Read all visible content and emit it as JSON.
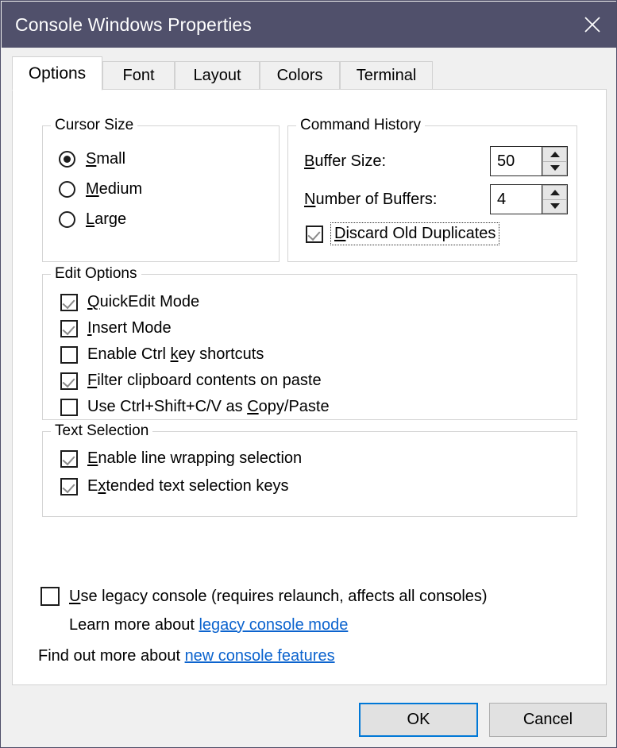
{
  "window": {
    "title": "Console Windows Properties",
    "close_icon": "close-icon",
    "titlebar_color": "#50506b"
  },
  "tabs": [
    {
      "label": "Options",
      "active": true
    },
    {
      "label": "Font",
      "active": false
    },
    {
      "label": "Layout",
      "active": false
    },
    {
      "label": "Colors",
      "active": false
    },
    {
      "label": "Terminal",
      "active": false
    }
  ],
  "cursor_size": {
    "title": "Cursor Size",
    "options": [
      {
        "label": "Small",
        "accel": "S",
        "rest": "mall",
        "selected": true
      },
      {
        "label": "Medium",
        "accel": "M",
        "rest": "edium",
        "selected": false
      },
      {
        "label": "Large",
        "accel": "L",
        "rest": "arge",
        "selected": false
      }
    ]
  },
  "command_history": {
    "title": "Command History",
    "buffer_size": {
      "label_accel": "B",
      "label_rest": "uffer Size:",
      "value": "50"
    },
    "number_of_buffers": {
      "label_accel": "N",
      "label_rest": "umber of Buffers:",
      "value": "4"
    },
    "discard_old_duplicates": {
      "accel": "D",
      "rest": "iscard Old Duplicates",
      "checked": true,
      "focused": true
    }
  },
  "edit_options": {
    "title": "Edit Options",
    "items": [
      {
        "pre": "",
        "accel": "Q",
        "rest": "uickEdit Mode",
        "checked": true
      },
      {
        "pre": "",
        "accel": "I",
        "rest": "nsert Mode",
        "checked": true
      },
      {
        "pre": "Enable Ctrl ",
        "accel": "k",
        "rest": "ey shortcuts",
        "checked": false
      },
      {
        "pre": "",
        "accel": "F",
        "rest": "ilter clipboard contents on paste",
        "checked": true
      },
      {
        "pre": "Use Ctrl+Shift+C/V as ",
        "accel": "C",
        "rest": "opy/Paste",
        "checked": false
      }
    ]
  },
  "text_selection": {
    "title": "Text Selection",
    "items": [
      {
        "pre": "",
        "accel": "E",
        "rest": "nable line wrapping selection",
        "checked": true
      },
      {
        "pre": "E",
        "accel": "x",
        "rest": "tended text selection keys",
        "checked": true
      }
    ]
  },
  "legacy": {
    "checkbox": {
      "accel": "U",
      "rest": "se legacy console (requires relaunch, affects all consoles)",
      "checked": false
    },
    "learn_more_prefix": "Learn more about ",
    "learn_more_link": "legacy console mode",
    "find_out_prefix": "Find out more about ",
    "find_out_link": "new console features"
  },
  "footer": {
    "ok_label": "OK",
    "cancel_label": "Cancel",
    "default_button_color": "#0078d7"
  }
}
